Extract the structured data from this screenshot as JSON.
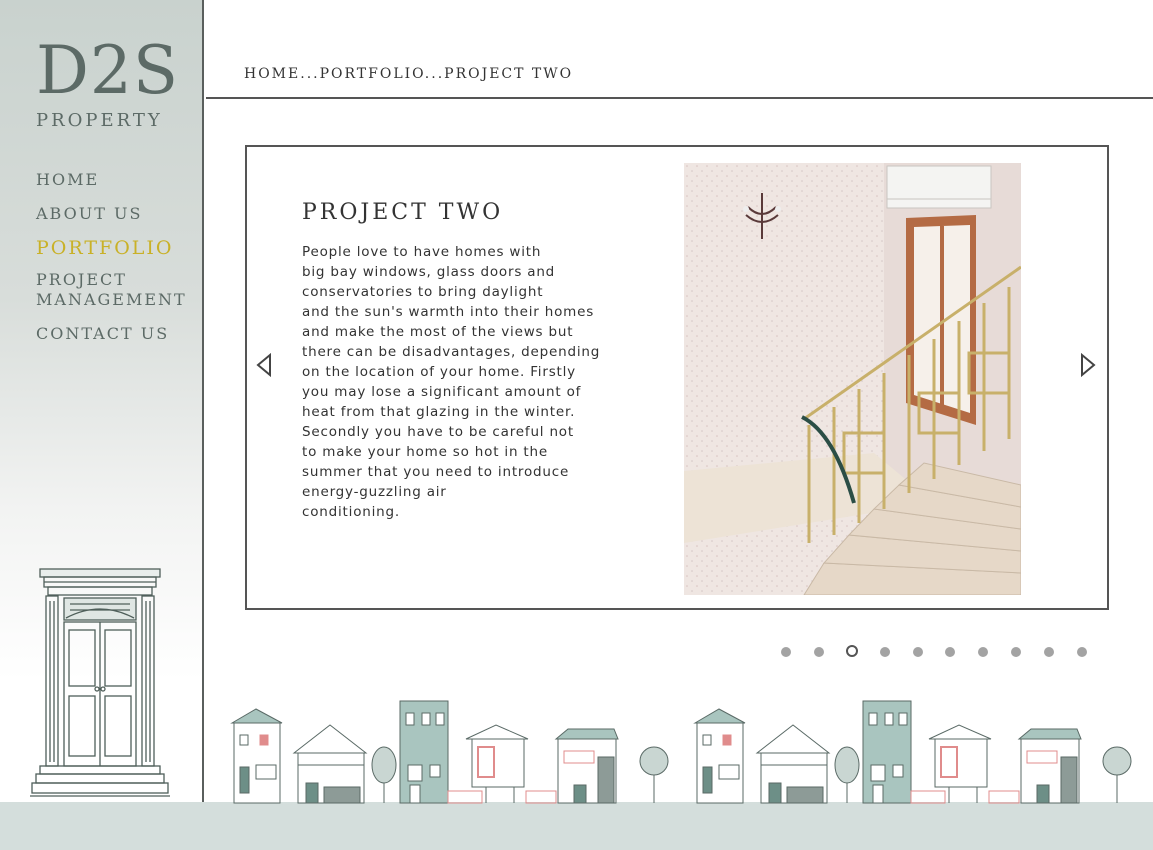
{
  "logo": {
    "main": "D2S",
    "sub": "PROPERTY"
  },
  "nav": {
    "items": [
      {
        "label": "HOME"
      },
      {
        "label": "ABOUT US"
      },
      {
        "label": "PORTFOLIO",
        "active": true
      },
      {
        "label_line1": "PROJECT",
        "label_line2": "MANAGEMENT"
      },
      {
        "label": "CONTACT US"
      }
    ]
  },
  "breadcrumb": "HOME...PORTFOLIO...PROJECT TWO",
  "project": {
    "title": "PROJECT TWO",
    "lines": [
      "People love to have homes with",
      "big bay windows, glass doors and",
      "conservatories to bring daylight",
      "and the sun's warmth into their homes",
      "and make the most of the views but",
      "there can be disadvantages, depending",
      "on the location of your home. Firstly",
      "you may lose a significant amount of",
      "heat from that glazing in the winter.",
      "Secondly you have to be careful not",
      "to make your home so hot in the",
      "summer that you need to introduce",
      "energy-guzzling air",
      "conditioning."
    ]
  },
  "carousel": {
    "total": 10,
    "active_index": 2
  },
  "colors": {
    "accent": "#c9b127",
    "sage": "#5c6a66",
    "ground": "#d4dedc"
  }
}
